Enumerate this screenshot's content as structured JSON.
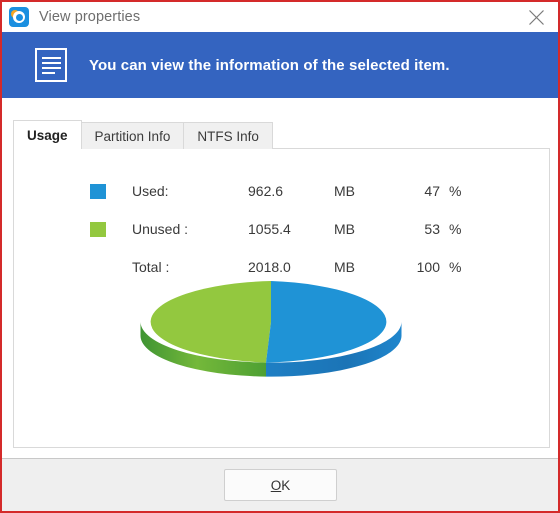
{
  "window": {
    "title": "View properties",
    "app_icon": "disc-app-icon",
    "close_icon": "close-icon"
  },
  "banner": {
    "icon": "document-lines-icon",
    "message": "You can view the information of the selected item.",
    "background": "#3464c0"
  },
  "tabs": [
    {
      "label": "Usage",
      "active": true
    },
    {
      "label": "Partition Info",
      "active": false
    },
    {
      "label": "NTFS Info",
      "active": false
    }
  ],
  "usage": {
    "rows": [
      {
        "swatch": "#1f93d6",
        "label": "Used:",
        "value": "962.6",
        "unit": "MB",
        "percent": "47",
        "percent_sign": "%"
      },
      {
        "swatch": "#93c83f",
        "label": "Unused :",
        "value": "1055.4",
        "unit": "MB",
        "percent": "53",
        "percent_sign": "%"
      },
      {
        "swatch": null,
        "label": "Total :",
        "value": "2018.0",
        "unit": "MB",
        "percent": "100",
        "percent_sign": "%"
      }
    ]
  },
  "chart_data": {
    "type": "pie",
    "title": "",
    "categories": [
      "Used",
      "Unused"
    ],
    "values": [
      47,
      53
    ],
    "value_labels": [
      "962.6 MB",
      "1055.4 MB"
    ],
    "total": 2018.0,
    "unit": "MB",
    "colors": [
      "#1f93d6",
      "#93c83f"
    ],
    "side_colors": [
      "#1b72b8",
      "#53a734"
    ],
    "three_d": true,
    "start_angle_deg": 0,
    "legend": "left-of-chart",
    "grid": false
  },
  "footer": {
    "ok_label_mnemonic": "O",
    "ok_label_rest": "K"
  }
}
